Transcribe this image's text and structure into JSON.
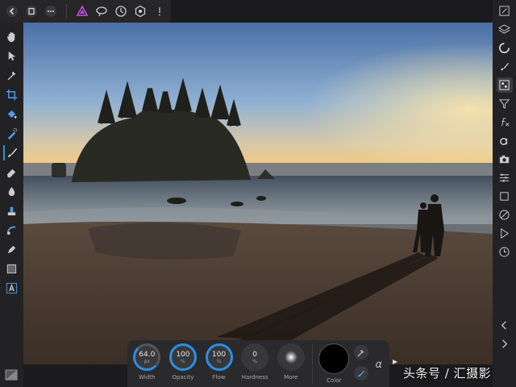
{
  "context_toolbar": {
    "width": {
      "value": "64.0",
      "unit": "px",
      "label": "Width",
      "level_fraction": 0.3
    },
    "opacity": {
      "value": "100",
      "unit": "%",
      "label": "Opacity",
      "level_fraction": 1.0
    },
    "flow": {
      "value": "100",
      "unit": "%",
      "label": "Flow",
      "level_fraction": 1.0
    },
    "hardness": {
      "value": "0",
      "unit": "%",
      "label": "Hardness",
      "level_fraction": 0.0
    },
    "more": {
      "label": "More"
    },
    "color": {
      "label": "Color",
      "value": "#000000"
    },
    "alpha_symbol": "α"
  },
  "watermark": "头条号 / 汇摄影",
  "colors": {
    "accent": "#2c8ee6",
    "panel": "#222224",
    "topbar": "#262628",
    "persona_icon": "#c050e0"
  },
  "top_toolbar": [
    "back-icon",
    "document-icon",
    "more-icon",
    "persona-icon",
    "assistant-icon",
    "history-icon",
    "settings-icon",
    "alert-icon"
  ],
  "left_tools": [
    "hand-icon",
    "move-icon",
    "color-picker-icon",
    "crop-icon",
    "fill-icon",
    "selection-brush-icon",
    "paint-brush-icon",
    "eraser-icon",
    "dodge-icon",
    "clone-icon",
    "healing-icon",
    "pen-icon",
    "shape-icon",
    "text-icon"
  ],
  "right_studio": [
    "navigator-icon",
    "layers-icon",
    "adjustments-icon",
    "brushes-icon",
    "channels-icon",
    "filter-icon",
    "fx-icon",
    "styles-icon",
    "camera-icon",
    "transform-icon",
    "stock-icon",
    "history-icon",
    "play-icon",
    "clock-icon",
    "collapse-icon",
    "expand-icon"
  ]
}
